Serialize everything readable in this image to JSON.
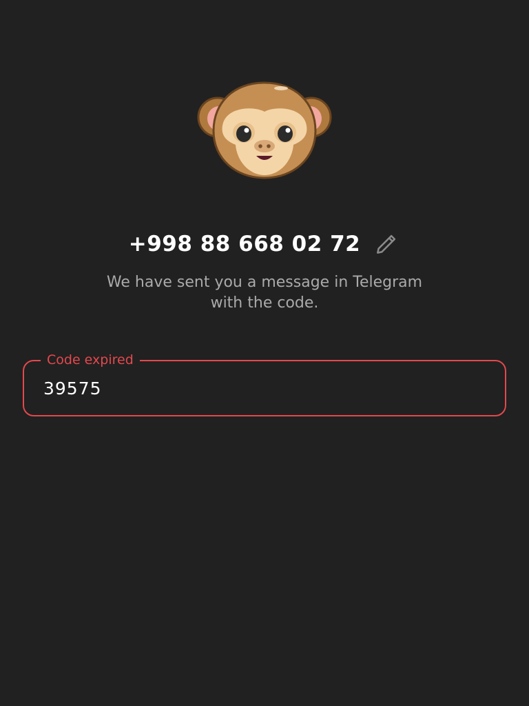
{
  "header": {
    "illustration": "monkey-face-emoji",
    "phone_number": "+998 88 668 02 72",
    "edit_icon": "pencil-icon"
  },
  "subtitle": {
    "line1": "We have sent you a message in Telegram",
    "line2": "with the code."
  },
  "code_field": {
    "label": "Code expired",
    "value": "39575"
  },
  "colors": {
    "background": "#212121",
    "error": "#e5484d",
    "text_primary": "#ffffff",
    "text_secondary": "#aaaaaa"
  }
}
